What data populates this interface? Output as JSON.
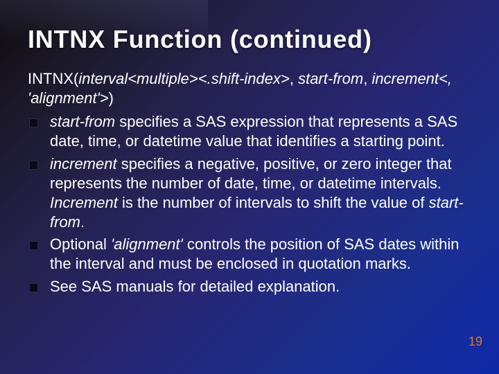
{
  "title": "INTNX Function (continued)",
  "syntax": {
    "fn": "INTNX(",
    "arg1": "interval",
    "arg2_open": "<multiple>",
    "arg3_open": "<.shift-index>",
    "sep1": ", ",
    "arg4": "start-from",
    "sep2": ", ",
    "arg5": "increment",
    "arg6_open": "<, ",
    "arg7": "'alignment'",
    "arg6_close": ">",
    "close": ")"
  },
  "bullets": {
    "b1": {
      "term": "start-from",
      "rest": " specifies a SAS expression that represents a SAS date, time, or datetime value that identifies a starting point."
    },
    "b2": {
      "term": "increment",
      "mid1": " specifies a negative, positive, or zero integer that represents the number of date, time, or datetime intervals. ",
      "term2": "Increment",
      "mid2": " is the number of intervals to shift the value of ",
      "term3": "start-from",
      "tail": "."
    },
    "b3": {
      "pre": "Optional ",
      "term": "'alignment'",
      "rest": " controls the position of SAS dates within the interval and must be enclosed in quotation marks."
    },
    "b4": {
      "text": "See SAS manuals for detailed explanation."
    }
  },
  "page_number": "19"
}
